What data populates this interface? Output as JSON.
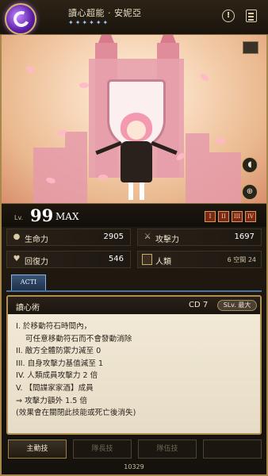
{
  "header": {
    "title": "讀心超能 · 安妮亞",
    "stars": "✦✦✦✦✦✦"
  },
  "level": {
    "prefix": "Lv.",
    "value": "99",
    "max_label": "MAX",
    "tiers": [
      "I",
      "II",
      "III",
      "IV"
    ]
  },
  "stats": {
    "hp_label": "生命力",
    "hp_value": "2905",
    "atk_label": "攻擊力",
    "atk_value": "1697",
    "rec_label": "回復力",
    "rec_value": "546",
    "race_label": "人類",
    "space_text": "6 空間 24"
  },
  "skill_tab": {
    "label": "ACTI"
  },
  "skill": {
    "name": "讀心術",
    "cd": "CD 7",
    "slv": "SLv. 最大",
    "lines": [
      "I. 於移動符石時間內，",
      "   可任意移動符石而不會發動消除",
      "II. 敵方全體防禦力減至 0",
      "III. 自身攻擊力基值減至 1",
      "IV. 人類成員攻擊力 2 倍",
      "V. 【間諜家家酒】成員",
      "⇒ 攻擊力額外 1.5 倍",
      "(效果會在關閉此技能或死亡後消失)"
    ]
  },
  "bottom_tabs": {
    "active_skill": "主動技",
    "leader_skill": "隊長技",
    "team_skill": "隊伍技",
    "extra": ""
  },
  "footer": {
    "number": "10329"
  },
  "colors": {
    "frame_gold": "#a8874a",
    "tab_blue": "#3a5476",
    "panel_bg": "#f3ead8"
  }
}
